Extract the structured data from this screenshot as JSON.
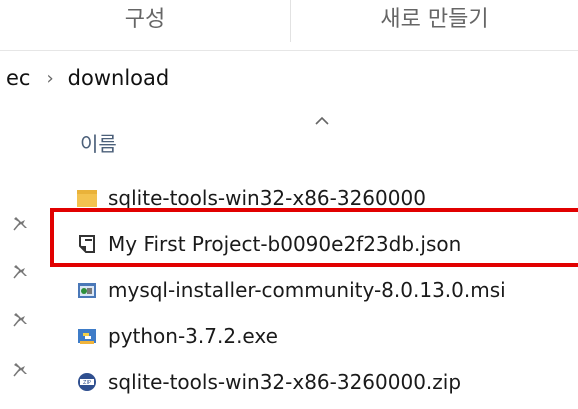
{
  "ribbon": {
    "groups": [
      {
        "label": "구성"
      },
      {
        "label": "새로 만들기"
      }
    ]
  },
  "breadcrumb": {
    "items": [
      "ec",
      "download"
    ],
    "separator": "›"
  },
  "file_list": {
    "column_header": "이름",
    "sort_direction": "ascending",
    "files": [
      {
        "name": "sqlite-tools-win32-x86-3260000",
        "icon": "folder-icon",
        "selected": false
      },
      {
        "name": "My First Project-b0090e2f23db.json",
        "icon": "json-file-icon",
        "selected": true
      },
      {
        "name": "mysql-installer-community-8.0.13.0.msi",
        "icon": "msi-installer-icon",
        "selected": false
      },
      {
        "name": "python-3.7.2.exe",
        "icon": "python-installer-icon",
        "selected": false
      },
      {
        "name": "sqlite-tools-win32-x86-3260000.zip",
        "icon": "zip-archive-icon",
        "selected": false
      }
    ]
  },
  "nav_pane": {
    "pinned_icons": [
      "pin-icon",
      "pin-icon",
      "pin-icon",
      "pin-icon"
    ]
  },
  "colors": {
    "highlight_border": "#e10000",
    "folder": "#f3c24f",
    "header_text": "#4c607a"
  }
}
